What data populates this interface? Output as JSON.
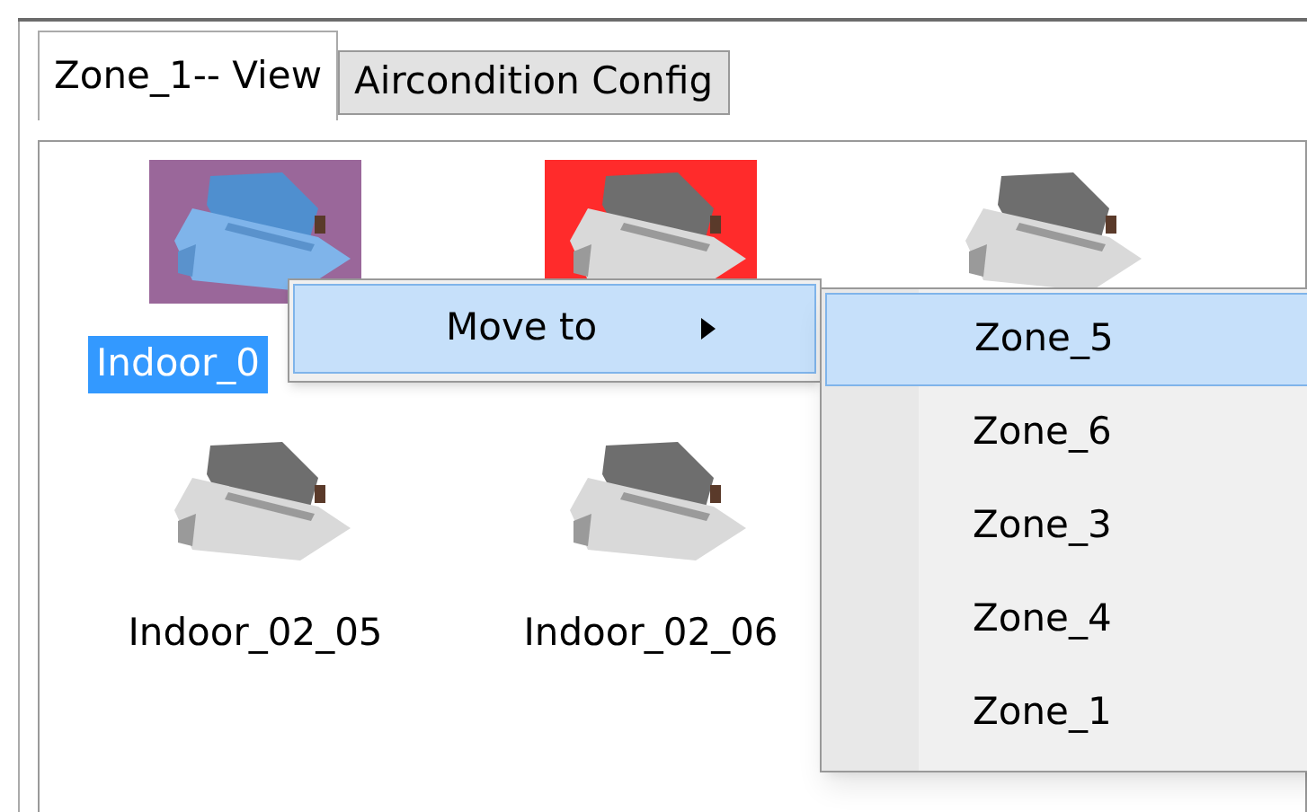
{
  "tabs": [
    {
      "label": "Zone_1-- View",
      "selected": true
    },
    {
      "label": "Aircondition Config",
      "selected": false
    }
  ],
  "devices": [
    {
      "label": "Indoor_0",
      "selected": true,
      "color": "#9a679a"
    },
    {
      "selected": false,
      "color": "#ff2b2b"
    },
    {
      "selected": false
    },
    {
      "label": "Indoor_02_05",
      "selected": false
    },
    {
      "label": "Indoor_02_06",
      "selected": false
    }
  ],
  "context_menu": {
    "items": [
      {
        "label": "Move to",
        "selected": true
      }
    ]
  },
  "submenu": {
    "items": [
      {
        "label": "Zone_5",
        "selected": true
      },
      {
        "label": "Zone_6",
        "selected": false
      },
      {
        "label": "Zone_3",
        "selected": false
      },
      {
        "label": "Zone_4",
        "selected": false
      },
      {
        "label": "Zone_1",
        "selected": false
      }
    ]
  }
}
